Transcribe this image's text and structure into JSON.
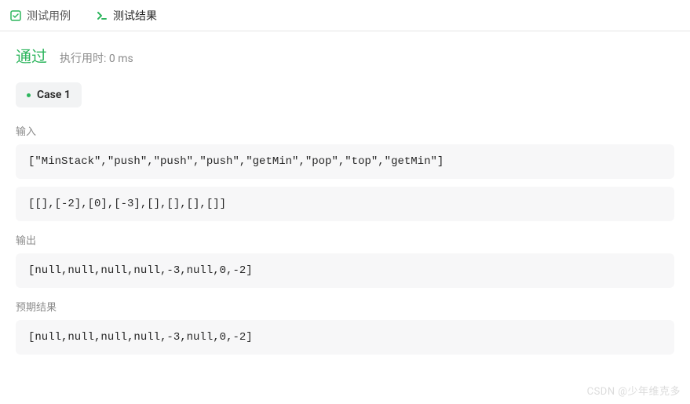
{
  "tabs": {
    "testcase": "测试用例",
    "result": "测试结果"
  },
  "status": {
    "label": "通过",
    "runtime": "执行用时: 0 ms"
  },
  "case": {
    "label": "Case 1"
  },
  "sections": {
    "input_label": "输入",
    "input_line1": "[\"MinStack\",\"push\",\"push\",\"push\",\"getMin\",\"pop\",\"top\",\"getMin\"]",
    "input_line2": "[[],[-2],[0],[-3],[],[],[],[]]",
    "output_label": "输出",
    "output_value": "[null,null,null,null,-3,null,0,-2]",
    "expected_label": "预期结果",
    "expected_value": "[null,null,null,null,-3,null,0,-2]"
  },
  "watermark": "CSDN @少年维克多"
}
